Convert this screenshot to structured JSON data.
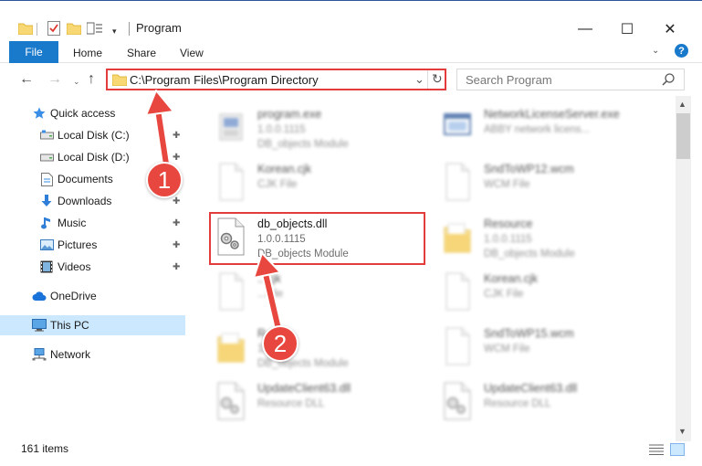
{
  "window": {
    "title": "Program",
    "controls": {
      "minimize": "—",
      "maximize": "☐",
      "close": "✕"
    }
  },
  "quick_access_toolbar": {
    "icons": [
      "folder-icon",
      "properties-check-icon",
      "new-folder-icon",
      "properties-list-icon"
    ],
    "dropdown_glyph": "▾"
  },
  "ribbon": {
    "tabs": [
      {
        "label": "File",
        "active": true
      },
      {
        "label": "Home"
      },
      {
        "label": "Share"
      },
      {
        "label": "View"
      }
    ],
    "expand_glyph": "⌄",
    "help_glyph": "?"
  },
  "navigation": {
    "back_glyph": "←",
    "forward_glyph": "→",
    "recent_glyph": "⌄",
    "up_glyph": "↑",
    "address": "C:\\Program Files\\Program Directory",
    "address_chevron": "⌄",
    "refresh_glyph": "↻",
    "search_placeholder": "Search Program"
  },
  "nav_pane": {
    "items": [
      {
        "label": "Quick access",
        "icon": "star-icon",
        "level": 0
      },
      {
        "label": "Local Disk (C:)",
        "icon": "drive-icon",
        "level": 1,
        "pinned": true
      },
      {
        "label": "Local Disk (D:)",
        "icon": "drive-icon",
        "level": 1,
        "pinned": true
      },
      {
        "label": "Documents",
        "icon": "documents-icon",
        "level": 1,
        "pinned": true
      },
      {
        "label": "Downloads",
        "icon": "download-icon",
        "level": 1,
        "pinned": true
      },
      {
        "label": "Music",
        "icon": "music-icon",
        "level": 1,
        "pinned": true
      },
      {
        "label": "Pictures",
        "icon": "pictures-icon",
        "level": 1,
        "pinned": true
      },
      {
        "label": "Videos",
        "icon": "videos-icon",
        "level": 1,
        "pinned": true
      },
      {
        "label": "OneDrive",
        "icon": "cloud-icon",
        "level": 0
      },
      {
        "label": "This PC",
        "icon": "computer-icon",
        "level": 0,
        "selected": true
      },
      {
        "label": "Network",
        "icon": "network-icon",
        "level": 0
      }
    ],
    "pin_glyph": "📌"
  },
  "files": [
    {
      "name": "program.exe",
      "sub1": "1.0.0.1115",
      "sub2": "DB_objects Module",
      "icon": "exe-icon"
    },
    {
      "name": "NetworkLicenseServer.exe",
      "sub1": "ABBY network licens...",
      "sub2": "",
      "icon": "window-exe-icon"
    },
    {
      "name": "Korean.cjk",
      "sub1": "CJK File",
      "sub2": "",
      "icon": "file-icon"
    },
    {
      "name": "SndToWP12.wcm",
      "sub1": "WCM File",
      "sub2": "",
      "icon": "file-icon"
    },
    {
      "name": "db_objects.dll",
      "sub1": "1.0.0.1115",
      "sub2": "DB_objects Module",
      "icon": "dll-icon"
    },
    {
      "name": "Resource",
      "sub1": "1.0.0.1115",
      "sub2": "DB_objects Module",
      "icon": "folder-icon"
    },
    {
      "name": "...cjk",
      "sub1": "...File",
      "sub2": "",
      "icon": "file-icon"
    },
    {
      "name": "Korean.cjk",
      "sub1": "CJK File",
      "sub2": "",
      "icon": "file-icon"
    },
    {
      "name": "R...ce",
      "sub1": "1...",
      "sub2": "DB_objects Module",
      "icon": "folder-icon"
    },
    {
      "name": "SndToWP15.wcm",
      "sub1": "WCM File",
      "sub2": "",
      "icon": "file-icon"
    },
    {
      "name": "UpdateClient63.dll",
      "sub1": "Resource DLL",
      "sub2": "",
      "icon": "dll-icon"
    },
    {
      "name": "UpdateClient63.dll",
      "sub1": "Resource DLL",
      "sub2": "",
      "icon": "dll-icon"
    }
  ],
  "status": {
    "item_count": "161 items"
  },
  "callouts": {
    "step1": "1",
    "step2": "2"
  },
  "colors": {
    "accent_blue": "#1979ca",
    "highlight_red": "#e33c3c",
    "callout_red": "#e8473f",
    "selection_blue": "#cce8ff",
    "folder_yellow": "#f8d775"
  },
  "scrollbar": {
    "up_glyph": "▲",
    "down_glyph": "▼"
  }
}
